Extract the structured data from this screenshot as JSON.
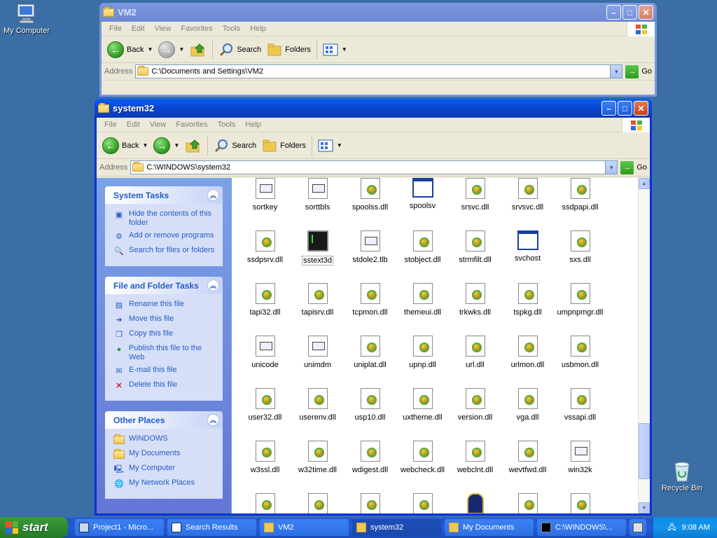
{
  "desktop": {
    "icons": [
      {
        "label": "My Computer"
      },
      {
        "label": "Recycle Bin"
      }
    ]
  },
  "vm2_window": {
    "title": "VM2",
    "menu": [
      "File",
      "Edit",
      "View",
      "Favorites",
      "Tools",
      "Help"
    ],
    "toolbar": {
      "back": "Back",
      "search": "Search",
      "folders": "Folders"
    },
    "address_label": "Address",
    "address": "C:\\Documents and Settings\\VM2",
    "go": "Go"
  },
  "main_window": {
    "title": "system32",
    "menu": [
      "File",
      "Edit",
      "View",
      "Favorites",
      "Tools",
      "Help"
    ],
    "toolbar": {
      "back": "Back",
      "search": "Search",
      "folders": "Folders"
    },
    "address_label": "Address",
    "address": "C:\\WINDOWS\\system32",
    "go": "Go",
    "task_pane": {
      "system_tasks": {
        "title": "System Tasks",
        "items": [
          "Hide the contents of this folder",
          "Add or remove programs",
          "Search for files or folders"
        ]
      },
      "file_tasks": {
        "title": "File and Folder Tasks",
        "items": [
          "Rename this file",
          "Move this file",
          "Copy this file",
          "Publish this file to the Web",
          "E-mail this file",
          "Delete this file"
        ]
      },
      "other_places": {
        "title": "Other Places",
        "items": [
          "WINDOWS",
          "My Documents",
          "My Computer",
          "My Network Places"
        ]
      }
    },
    "files": [
      {
        "name": "sortkey",
        "icon": "doc-icon"
      },
      {
        "name": "sorttbls",
        "icon": "doc-icon"
      },
      {
        "name": "spoolss.dll",
        "icon": "dll-icon"
      },
      {
        "name": "spoolsv",
        "icon": "exe-icon"
      },
      {
        "name": "srsvc.dll",
        "icon": "dll-icon"
      },
      {
        "name": "srvsvc.dll",
        "icon": "dll-icon"
      },
      {
        "name": "ssdpapi.dll",
        "icon": "dll-icon"
      },
      {
        "name": "ssdpsrv.dll",
        "icon": "dll-icon"
      },
      {
        "name": "sstext3d",
        "icon": "terminal-icon",
        "selected": true
      },
      {
        "name": "stdole2.tlb",
        "icon": "doc-icon"
      },
      {
        "name": "stobject.dll",
        "icon": "dll-icon"
      },
      {
        "name": "strmfilt.dll",
        "icon": "dll-icon"
      },
      {
        "name": "svchost",
        "icon": "exe-icon"
      },
      {
        "name": "sxs.dll",
        "icon": "dll-icon"
      },
      {
        "name": "tapi32.dll",
        "icon": "dll-icon"
      },
      {
        "name": "tapisrv.dll",
        "icon": "dll-icon"
      },
      {
        "name": "tcpmon.dll",
        "icon": "dll-icon"
      },
      {
        "name": "themeui.dll",
        "icon": "dll-icon"
      },
      {
        "name": "trkwks.dll",
        "icon": "dll-icon"
      },
      {
        "name": "tspkg.dll",
        "icon": "dll-icon"
      },
      {
        "name": "umpnpmgr.dll",
        "icon": "dll-icon"
      },
      {
        "name": "unicode",
        "icon": "doc-icon"
      },
      {
        "name": "unimdm",
        "icon": "doc-icon"
      },
      {
        "name": "uniplat.dll",
        "icon": "dll-icon"
      },
      {
        "name": "upnp.dll",
        "icon": "dll-icon"
      },
      {
        "name": "url.dll",
        "icon": "dll-icon"
      },
      {
        "name": "urlmon.dll",
        "icon": "dll-icon"
      },
      {
        "name": "usbmon.dll",
        "icon": "dll-icon"
      },
      {
        "name": "user32.dll",
        "icon": "dll-icon"
      },
      {
        "name": "userenv.dll",
        "icon": "dll-icon"
      },
      {
        "name": "usp10.dll",
        "icon": "dll-icon"
      },
      {
        "name": "uxtheme.dll",
        "icon": "dll-icon"
      },
      {
        "name": "version.dll",
        "icon": "dll-icon"
      },
      {
        "name": "vga.dll",
        "icon": "dll-icon"
      },
      {
        "name": "vssapi.dll",
        "icon": "dll-icon"
      },
      {
        "name": "w3ssl.dll",
        "icon": "dll-icon"
      },
      {
        "name": "w32time.dll",
        "icon": "dll-icon"
      },
      {
        "name": "wdigest.dll",
        "icon": "dll-icon"
      },
      {
        "name": "webcheck.dll",
        "icon": "dll-icon"
      },
      {
        "name": "webclnt.dll",
        "icon": "dll-icon"
      },
      {
        "name": "wevtfwd.dll",
        "icon": "dll-icon"
      },
      {
        "name": "win32k",
        "icon": "doc-icon"
      },
      {
        "name": "",
        "icon": "dll-icon"
      },
      {
        "name": "",
        "icon": "dll-icon"
      },
      {
        "name": "",
        "icon": "dll-icon"
      },
      {
        "name": "",
        "icon": "dll-icon"
      },
      {
        "name": "",
        "icon": "gate-icon"
      },
      {
        "name": "",
        "icon": "dll-icon"
      },
      {
        "name": "",
        "icon": "dll-icon"
      }
    ]
  },
  "taskbar": {
    "start_label": "start",
    "tasks": [
      {
        "label": "Project1 - Micro...",
        "icon": "vb-icon"
      },
      {
        "label": "Search Results",
        "icon": "search-results-icon"
      },
      {
        "label": "VM2",
        "icon": "folder-icon"
      },
      {
        "label": "system32",
        "icon": "folder-icon"
      },
      {
        "label": "My Documents",
        "icon": "folder-icon"
      },
      {
        "label": "C:\\WINDOWS\\...",
        "icon": "cmd-icon"
      }
    ],
    "clock": "9:08 AM"
  },
  "colors": {
    "desktop": "#3a6ea5",
    "title_active": "#0a5ef7",
    "task_link": "#215dc6",
    "start_green": "#2f8a2f"
  }
}
